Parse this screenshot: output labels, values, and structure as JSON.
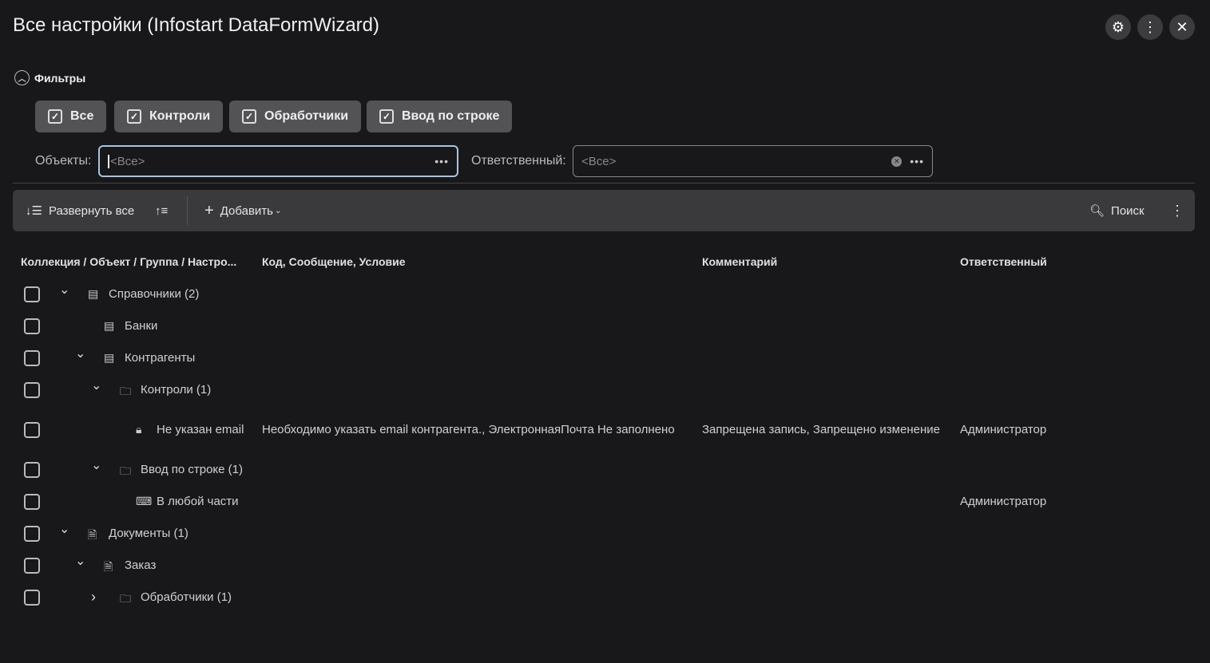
{
  "window": {
    "title": "Все настройки (Infostart DataFormWizard)"
  },
  "filters": {
    "label": "Фильтры",
    "chips": [
      "Все",
      "Контроли",
      "Обработчики",
      "Ввод по строке"
    ],
    "objects_label": "Объекты:",
    "objects_placeholder": "<Все>",
    "responsible_label": "Ответственный:",
    "responsible_placeholder": "<Все>"
  },
  "toolbar": {
    "expand_all": "Развернуть все",
    "add": "Добавить",
    "search": "Поиск"
  },
  "table": {
    "headers": [
      "Коллекция / Объект / Группа / Настро...",
      "Код, Сообщение, Условие",
      "Комментарий",
      "Ответственный"
    ],
    "rows": [
      {
        "name": "Справочники (2)",
        "code": "",
        "comment": "",
        "resp": ""
      },
      {
        "name": "Банки",
        "code": "",
        "comment": "",
        "resp": ""
      },
      {
        "name": "Контрагенты",
        "code": "",
        "comment": "",
        "resp": ""
      },
      {
        "name": "Контроли (1)",
        "code": "",
        "comment": "",
        "resp": ""
      },
      {
        "name": "Не указан email",
        "code": "Необходимо указать email контрагента., ЭлектроннаяПочта Не заполнено",
        "comment": "Запрещена запись, Запрещено изменение",
        "resp": "Администратор"
      },
      {
        "name": "Ввод по строке (1)",
        "code": "",
        "comment": "",
        "resp": ""
      },
      {
        "name": "В любой части",
        "code": "",
        "comment": "",
        "resp": "Администратор"
      },
      {
        "name": "Документы (1)",
        "code": "",
        "comment": "",
        "resp": ""
      },
      {
        "name": "Заказ",
        "code": "",
        "comment": "",
        "resp": ""
      },
      {
        "name": "Обработчики (1)",
        "code": "",
        "comment": "",
        "resp": ""
      }
    ]
  }
}
